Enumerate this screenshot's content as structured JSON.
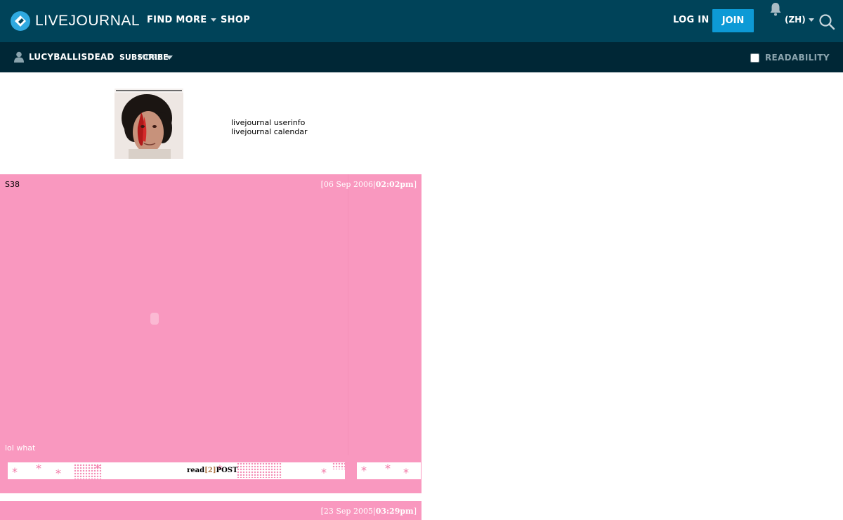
{
  "header": {
    "logo_text": "LIVEJOURNAL",
    "nav": {
      "find_more": "FIND MORE",
      "shop": "SHOP"
    },
    "login": "LOG IN",
    "join": "JOIN",
    "language": "(ZH)",
    "colors": {
      "bar": "#004359",
      "join_button": "#0d9ad6"
    }
  },
  "subnav": {
    "username": "LUCYBALLISDEAD",
    "subscribe": "SUBSCRIBE",
    "more": "MORE",
    "readability": "READABILITY",
    "readability_checked": false
  },
  "profile": {
    "links": [
      "livejournal userinfo",
      "livejournal calendar"
    ]
  },
  "entries": [
    {
      "title": "S38",
      "date": "06 Sep 2006",
      "time": "02:02pm",
      "body": "lol what",
      "read_label": "read",
      "comment_count": "2",
      "post_label": "POST"
    },
    {
      "title": "",
      "date": "23 Sep 2005",
      "time": "03:29pm"
    }
  ],
  "theme": {
    "entry_bg": "#f998bf"
  }
}
